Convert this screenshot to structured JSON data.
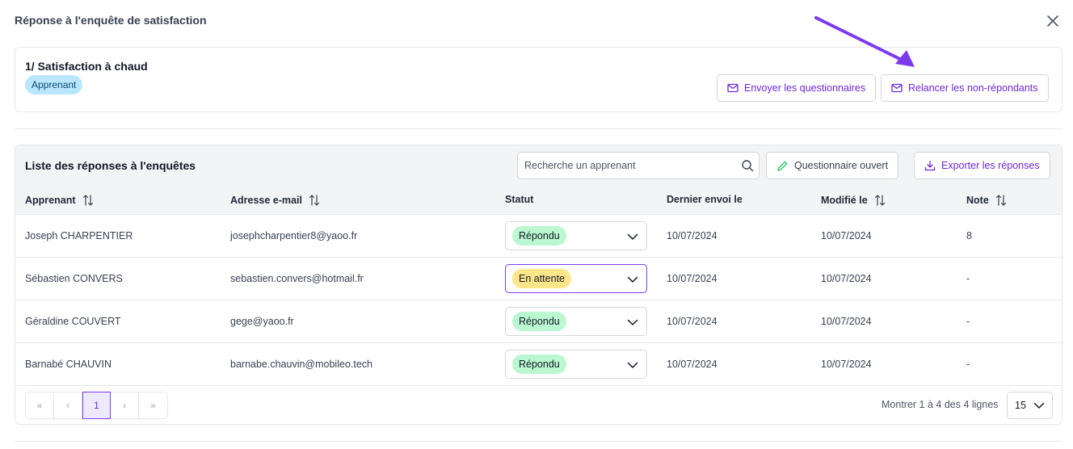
{
  "modal": {
    "title": "Réponse à l'enquête de satisfaction"
  },
  "survey": {
    "title": "1/ Satisfaction à chaud",
    "tag": "Apprenant",
    "send_button": "Envoyer les questionnaires",
    "remind_button": "Relancer les non-répondants"
  },
  "list": {
    "title": "Liste des réponses à l'enquêtes",
    "search_placeholder": "Recherche un apprenant",
    "open_questionnaire_button": "Questionnaire ouvert",
    "export_button": "Exporter les réponses",
    "columns": {
      "learner": "Apprenant",
      "email": "Adresse e-mail",
      "status": "Statut",
      "last_sent": "Dernier envoi le",
      "modified": "Modifié le",
      "score": "Note"
    },
    "rows": [
      {
        "name": "Joseph CHARPENTIER",
        "email": "josephcharpentier8@yaoo.fr",
        "status": "Répondu",
        "last_sent": "10/07/2024",
        "modified": "10/07/2024",
        "score": "8"
      },
      {
        "name": "Sébastien CONVERS",
        "email": "sebastien.convers@hotmail.fr",
        "status": "En attente",
        "last_sent": "10/07/2024",
        "modified": "10/07/2024",
        "score": "-"
      },
      {
        "name": "Géraldine COUVERT",
        "email": "gege@yaoo.fr",
        "status": "Répondu",
        "last_sent": "10/07/2024",
        "modified": "10/07/2024",
        "score": "-"
      },
      {
        "name": "Barnabé CHAUVIN",
        "email": "barnabe.chauvin@mobileo.tech",
        "status": "Répondu",
        "last_sent": "10/07/2024",
        "modified": "10/07/2024",
        "score": "-"
      }
    ]
  },
  "pagination": {
    "first": "«",
    "prev": "‹",
    "current_page": "1",
    "next": "›",
    "last": "»",
    "rows_info": "Montrer 1 à 4 des 4 lignes",
    "page_size": "15"
  },
  "colors": {
    "accent": "#7c3aed",
    "status_answered": "#bbf7d0",
    "status_pending": "#fde68a",
    "tag": "#bae6fd"
  }
}
